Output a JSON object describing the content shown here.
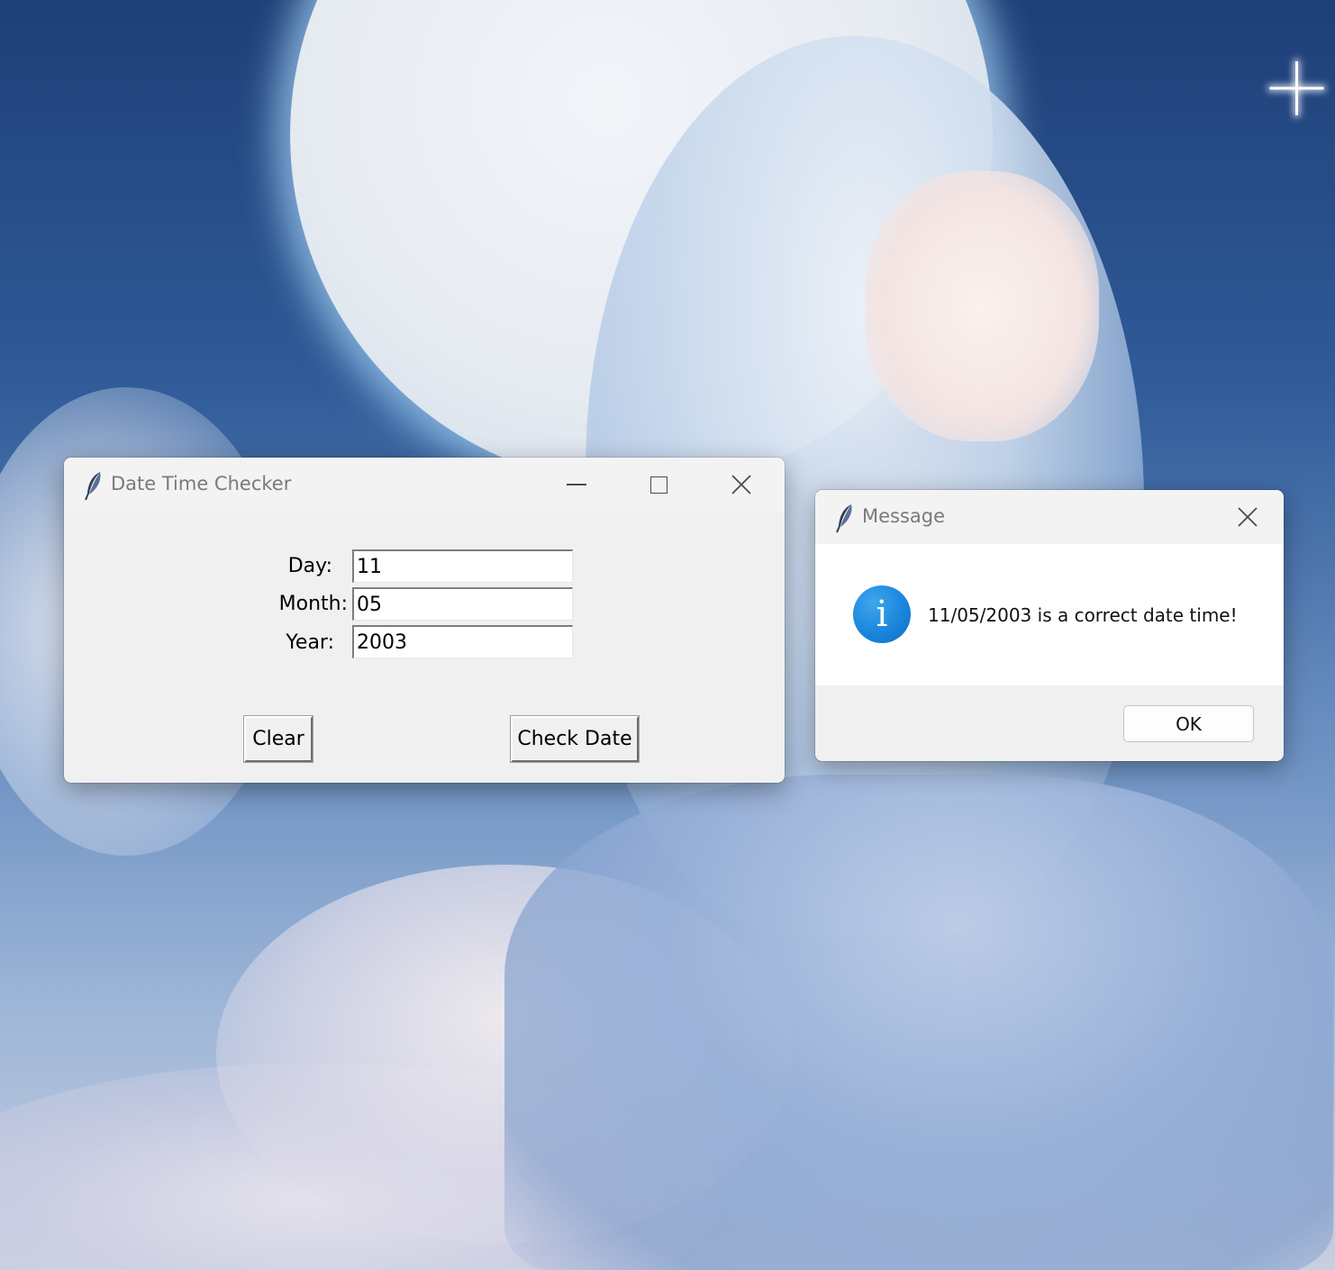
{
  "main_window": {
    "title": "Date Time Checker",
    "fields": {
      "day_label": "Day:",
      "day_value": "11",
      "month_label": "Month:",
      "month_value": "05",
      "year_label": "Year:",
      "year_value": "2003"
    },
    "buttons": {
      "clear": "Clear",
      "check": "Check Date"
    }
  },
  "message_dialog": {
    "title": "Message",
    "text": "11/05/2003 is a correct date time!",
    "icon": "info-icon",
    "info_glyph": "i",
    "ok": "OK"
  },
  "colors": {
    "info_blue": "#1a86dc"
  }
}
